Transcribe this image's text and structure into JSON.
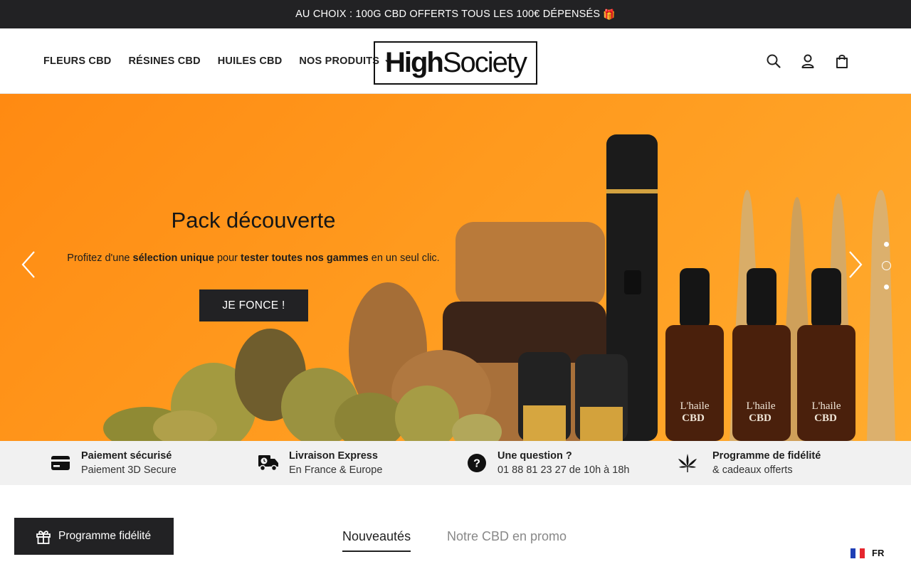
{
  "announcement": {
    "text": "AU CHOIX : 100G CBD OFFERTS TOUS LES 100€ DÉPENSÉS",
    "icon": "gift-emoji"
  },
  "nav": {
    "items": [
      {
        "label": "FLEURS CBD"
      },
      {
        "label": "RÉSINES CBD"
      },
      {
        "label": "HUILES CBD"
      },
      {
        "label": "NOS PRODUITS",
        "has_dropdown": true
      }
    ]
  },
  "logo": {
    "part1": "High",
    "part2": "Society"
  },
  "header_icons": [
    "search-icon",
    "account-icon",
    "cart-icon"
  ],
  "hero": {
    "title": "Pack découverte",
    "subtitle_parts": [
      "Profitez d'une ",
      "sélection unique",
      " pour ",
      "tester toutes nos gammes",
      " en un seul clic."
    ],
    "cta": "JE FONCE !",
    "bottle_brand": "L'haile",
    "bottle_label": "CBD",
    "slides": 3,
    "active_slide": 2,
    "bg_color": "#ff9a1e"
  },
  "features": [
    {
      "title": "Paiement sécurisé",
      "subtitle": "Paiement 3D Secure",
      "icon": "credit-card-icon"
    },
    {
      "title": "Livraison Express",
      "subtitle": "En France & Europe",
      "icon": "delivery-truck-icon"
    },
    {
      "title": "Une question ?",
      "subtitle": "01 88 81 23 27 de 10h à 18h",
      "icon": "question-icon"
    },
    {
      "title": "Programme de fidélité",
      "subtitle": "& cadeaux offerts",
      "icon": "cannabis-leaf-icon"
    }
  ],
  "tabs": [
    {
      "label": "Nouveautés",
      "active": true
    },
    {
      "label": "Notre CBD en promo",
      "active": false
    }
  ],
  "loyalty_button": {
    "label": "Programme fidélité"
  },
  "language": {
    "code": "FR"
  }
}
